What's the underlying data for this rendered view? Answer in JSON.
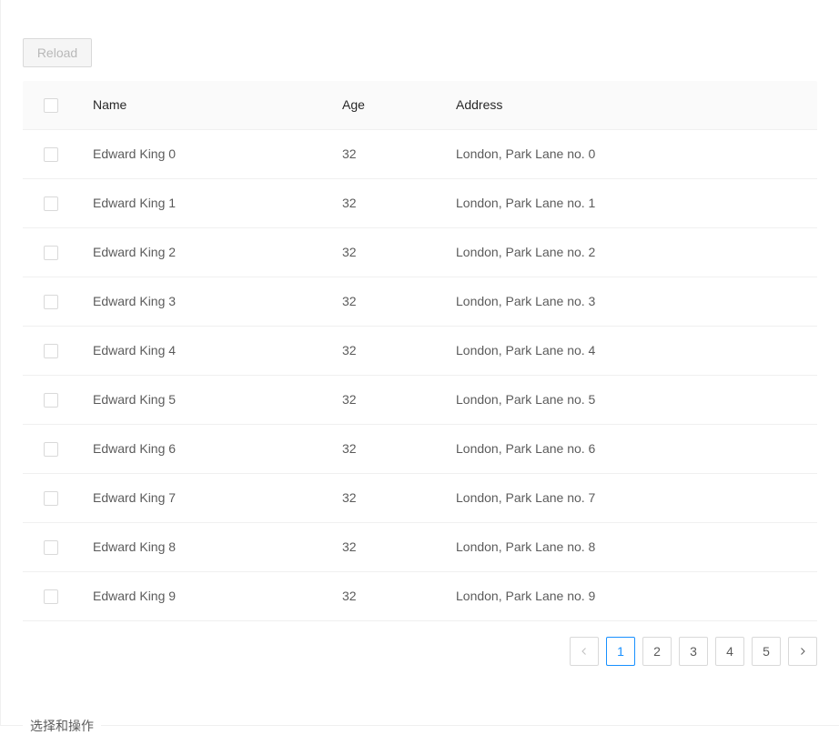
{
  "toolbar": {
    "reload_label": "Reload"
  },
  "table": {
    "columns": [
      "Name",
      "Age",
      "Address"
    ],
    "rows": [
      {
        "name": "Edward King 0",
        "age": "32",
        "address": "London, Park Lane no. 0"
      },
      {
        "name": "Edward King 1",
        "age": "32",
        "address": "London, Park Lane no. 1"
      },
      {
        "name": "Edward King 2",
        "age": "32",
        "address": "London, Park Lane no. 2"
      },
      {
        "name": "Edward King 3",
        "age": "32",
        "address": "London, Park Lane no. 3"
      },
      {
        "name": "Edward King 4",
        "age": "32",
        "address": "London, Park Lane no. 4"
      },
      {
        "name": "Edward King 5",
        "age": "32",
        "address": "London, Park Lane no. 5"
      },
      {
        "name": "Edward King 6",
        "age": "32",
        "address": "London, Park Lane no. 6"
      },
      {
        "name": "Edward King 7",
        "age": "32",
        "address": "London, Park Lane no. 7"
      },
      {
        "name": "Edward King 8",
        "age": "32",
        "address": "London, Park Lane no. 8"
      },
      {
        "name": "Edward King 9",
        "age": "32",
        "address": "London, Park Lane no. 9"
      }
    ]
  },
  "pagination": {
    "pages": [
      "1",
      "2",
      "3",
      "4",
      "5"
    ],
    "current": "1",
    "prev_icon": "chevron-left-icon",
    "next_icon": "chevron-right-icon"
  },
  "section": {
    "title": "选择和操作"
  },
  "colors": {
    "accent": "#1890ff",
    "header_bg": "#fafafa",
    "border": "#f0f0f0"
  }
}
